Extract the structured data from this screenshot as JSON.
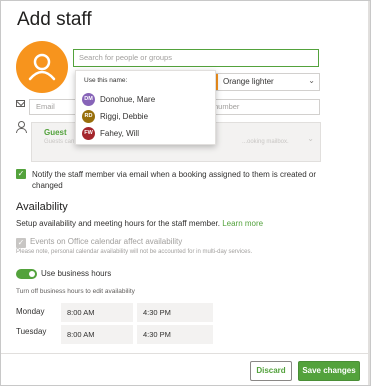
{
  "dialog": {
    "title": "Add staff"
  },
  "search": {
    "placeholder": "Search for people or groups"
  },
  "suggestions": {
    "heading": "Use this name:",
    "items": [
      {
        "initials": "DM",
        "name": "Donohue, Mare",
        "color": "#8764b8"
      },
      {
        "initials": "RD",
        "name": "Riggi, Debbie",
        "color": "#986f0b"
      },
      {
        "initials": "FW",
        "name": "Fahey, Will",
        "color": "#a4262c"
      }
    ]
  },
  "color": {
    "selected": "Orange lighter",
    "swatch": "#f7941d"
  },
  "contact": {
    "email_placeholder": "Email",
    "phone_placeholder": "number"
  },
  "role": {
    "title": "Guest",
    "description": "Guests can be assigned to bookings but can't open",
    "description_right": "...ooking mailbox."
  },
  "notify": {
    "checked": true,
    "label": "Notify the staff member via email when a booking assigned to them is created or changed"
  },
  "availability": {
    "title": "Availability",
    "description": "Setup availability and meeting hours for the staff member.",
    "learn_more": "Learn more",
    "office_calendar_label": "Events on Office calendar affect availability",
    "office_calendar_note": "Please note, personal calendar availability will not be accounted for in multi-day services.",
    "business_hours_label": "Use business hours",
    "business_hours_on": true,
    "business_hours_note": "Turn off business hours to edit availability",
    "days": [
      {
        "day": "Monday",
        "start": "8:00 AM",
        "end": "4:30 PM"
      },
      {
        "day": "Tuesday",
        "start": "8:00 AM",
        "end": "4:30 PM"
      }
    ]
  },
  "footer": {
    "discard": "Discard",
    "save": "Save changes"
  },
  "theme": {
    "accent": "#53a23c"
  }
}
